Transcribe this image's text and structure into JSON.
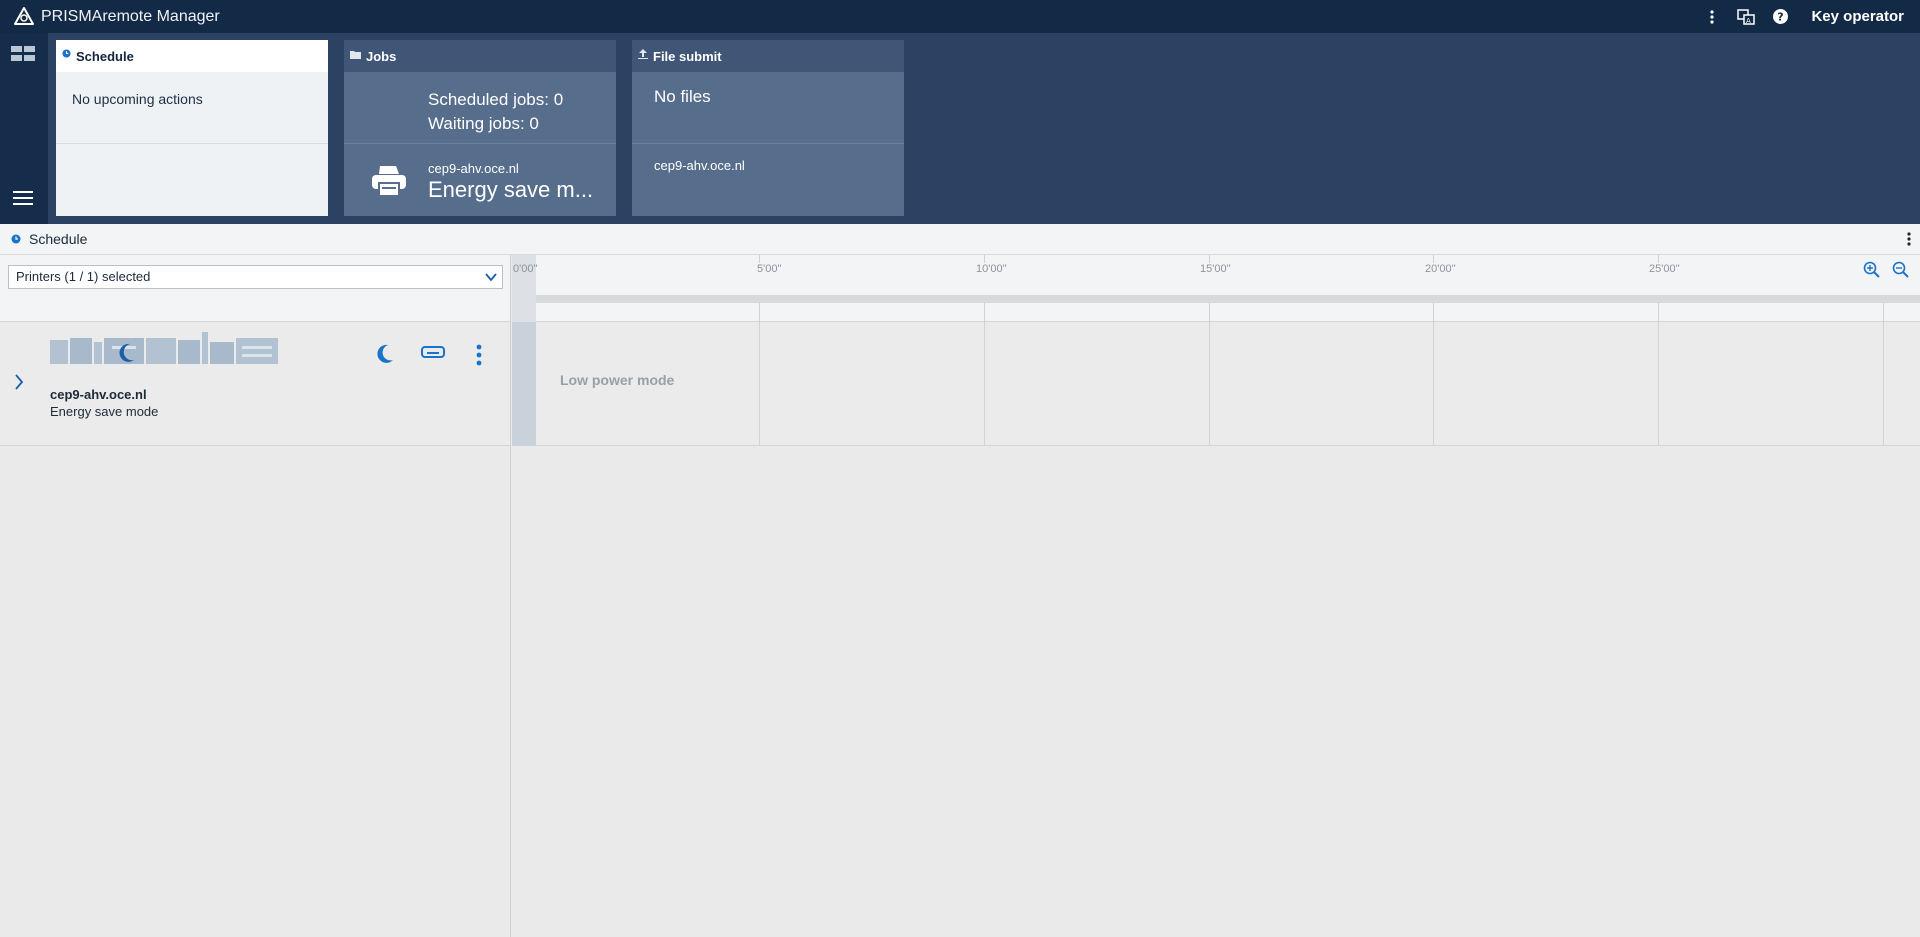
{
  "app": {
    "title": "PRISMAremote Manager",
    "user": "Key operator"
  },
  "icons": {
    "logo": "prisma-logo-icon",
    "kebab": "more-vertical-icon",
    "language": "translate-icon",
    "help": "help-icon",
    "dashboard": "grid-icon",
    "menu": "hamburger-icon",
    "clock": "clock-icon",
    "folder": "folder-icon",
    "upload": "upload-icon",
    "printer": "printer-icon",
    "chevron_down": "chevron-down-icon",
    "chevron_right": "chevron-right-icon",
    "moon": "moon-icon",
    "display": "display-icon",
    "zoom_in": "zoom-in-icon",
    "zoom_out": "zoom-out-icon"
  },
  "colors": {
    "topbar": "#132a47",
    "dashboard": "#2c4263",
    "tile_dark": "#566d8b",
    "accent": "#1a73c8"
  },
  "tiles": {
    "schedule": {
      "title": "Schedule",
      "message": "No upcoming actions"
    },
    "jobs": {
      "title": "Jobs",
      "scheduled": "Scheduled jobs: 0",
      "waiting": "Waiting jobs: 0",
      "printer_host": "cep9-ahv.oce.nl",
      "printer_state": "Energy save m..."
    },
    "file_submit": {
      "title": "File submit",
      "message": "No files",
      "printer_host": "cep9-ahv.oce.nl"
    }
  },
  "schedule": {
    "title": "Schedule",
    "filter": "Printers (1 / 1) selected",
    "printers": [
      {
        "name": "cep9-ahv.oce.nl",
        "state": "Energy save mode",
        "timeline_label": "Low power mode"
      }
    ],
    "ticks": [
      "0'00''",
      "5'00''",
      "10'00''",
      "15'00''",
      "20'00''",
      "25'00''"
    ]
  }
}
